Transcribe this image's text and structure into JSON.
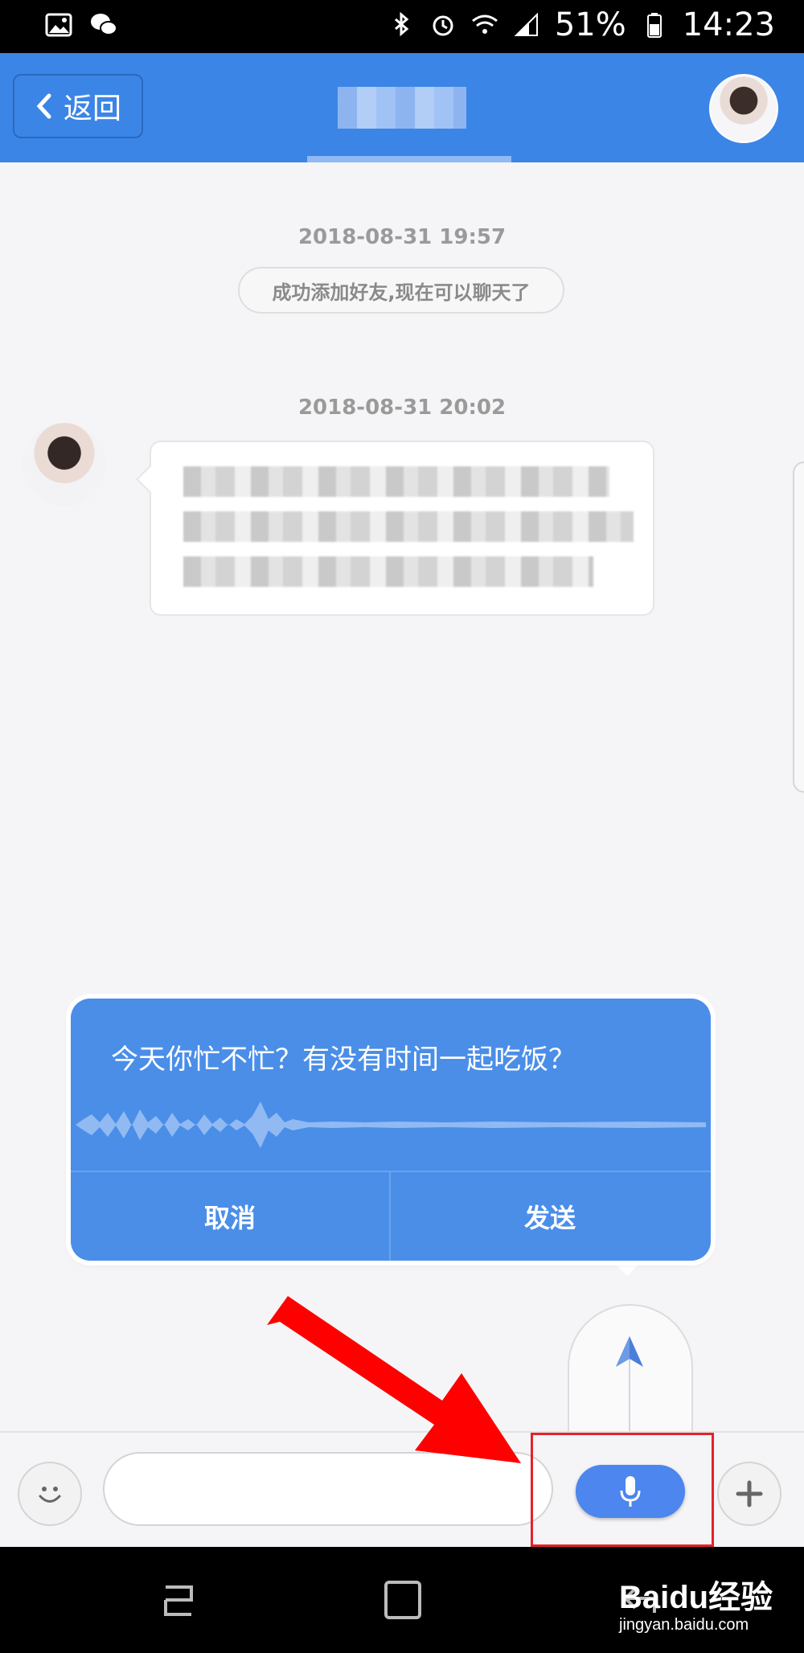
{
  "status_bar": {
    "battery_percent": "51%",
    "time": "14:23",
    "left_icons": [
      "gallery-icon",
      "wechat-icon"
    ],
    "right_icons": [
      "bluetooth-icon",
      "alarm-icon",
      "wifi-icon",
      "signal-icon",
      "battery-icon"
    ]
  },
  "header": {
    "back_label": "返回",
    "accent_color": "#3b85e6"
  },
  "messages": {
    "timestamp_1": "2018-08-31 19:57",
    "system_notice": "成功添加好友,现在可以聊天了",
    "timestamp_2": "2018-08-31 20:02"
  },
  "voice_popup": {
    "recognized_text": "今天你忙不忙？有没有时间一起吃饭？",
    "cancel_label": "取消",
    "send_label": "发送"
  },
  "input_bar": {
    "placeholder": ""
  },
  "watermark": {
    "main": "Baidu经验",
    "sub": "jingyan.baidu.com"
  }
}
